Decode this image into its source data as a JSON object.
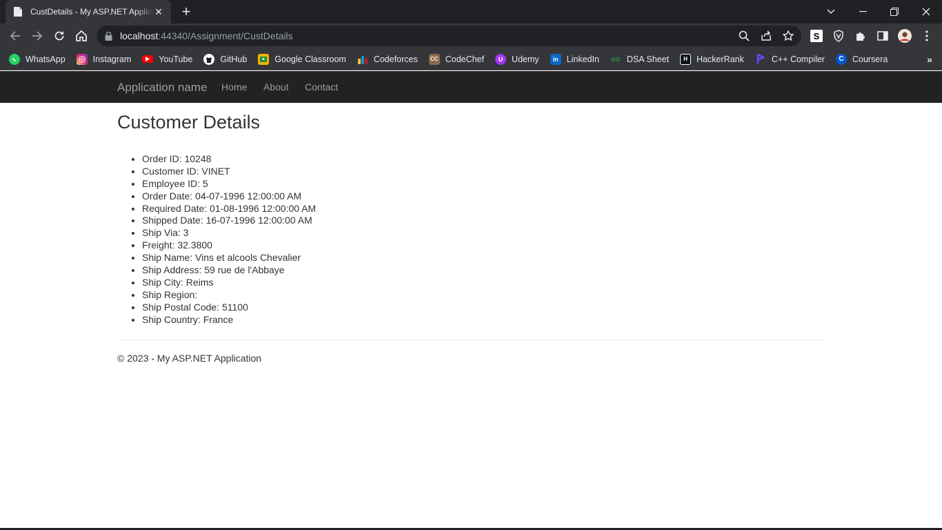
{
  "browser": {
    "tab_title": "CustDetails - My ASP.NET Application",
    "url_host": "localhost",
    "url_rest": ":44340/Assignment/CustDetails"
  },
  "bookmarks": [
    {
      "label": "WhatsApp",
      "icon": "whatsapp-icon",
      "color": "#25d366"
    },
    {
      "label": "Instagram",
      "icon": "instagram-icon",
      "color": "#e1306c"
    },
    {
      "label": "YouTube",
      "icon": "youtube-icon",
      "color": "#ff0000"
    },
    {
      "label": "GitHub",
      "icon": "github-icon",
      "color": "#ffffff"
    },
    {
      "label": "Google Classroom",
      "icon": "google-classroom-icon",
      "color": "#f4b400"
    },
    {
      "label": "Codeforces",
      "icon": "codeforces-icon",
      "color": "#1f8acb"
    },
    {
      "label": "CodeChef",
      "icon": "codechef-icon",
      "color": "#8a6a4a"
    },
    {
      "label": "Udemy",
      "icon": "udemy-icon",
      "color": "#a435f0"
    },
    {
      "label": "LinkedIn",
      "icon": "linkedin-icon",
      "color": "#0a66c2"
    },
    {
      "label": "DSA Sheet",
      "icon": "dsa-sheet-icon",
      "color": "#2f8d46"
    },
    {
      "label": "HackerRank",
      "icon": "hackerrank-icon",
      "color": "#000000"
    },
    {
      "label": "C++ Compiler",
      "icon": "cpp-compiler-icon",
      "color": "#6e44ff"
    },
    {
      "label": "Coursera",
      "icon": "coursera-icon",
      "color": "#0056d2"
    }
  ],
  "site": {
    "brand": "Application name",
    "nav": [
      "Home",
      "About",
      "Contact"
    ]
  },
  "page": {
    "title": "Customer Details",
    "details": [
      "Order ID: 10248",
      "Customer ID: VINET",
      "Employee ID: 5",
      "Order Date: 04-07-1996 12:00:00 AM",
      "Required Date: 01-08-1996 12:00:00 AM",
      "Shipped Date: 16-07-1996 12:00:00 AM",
      "Ship Via: 3",
      "Freight: 32.3800",
      "Ship Name: Vins et alcools Chevalier",
      "Ship Address: 59 rue de l'Abbaye",
      "Ship City: Reims",
      "Ship Region:",
      "Ship Postal Code: 51100",
      "Ship Country: France"
    ],
    "footer": "© 2023 - My ASP.NET Application"
  }
}
